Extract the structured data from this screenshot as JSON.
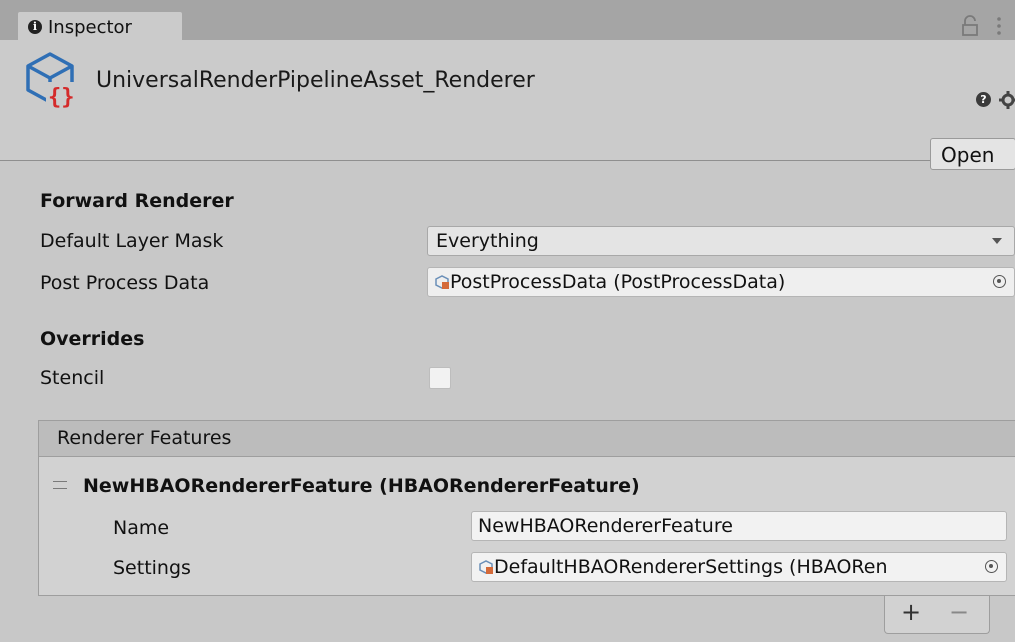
{
  "tab": {
    "label": "Inspector",
    "icon": "info-icon"
  },
  "header": {
    "title": "UniversalRenderPipelineAsset_Renderer",
    "open_label": "Open",
    "help_glyph": "?"
  },
  "forward_renderer": {
    "section_title": "Forward Renderer",
    "default_layer_mask_label": "Default Layer Mask",
    "default_layer_mask_value": "Everything",
    "post_process_data_label": "Post Process Data",
    "post_process_data_value": "PostProcessData (PostProcessData)"
  },
  "overrides": {
    "section_title": "Overrides",
    "stencil_label": "Stencil",
    "stencil_checked": false
  },
  "renderer_features": {
    "header": "Renderer Features",
    "items": [
      {
        "title": "NewHBAORendererFeature (HBAORendererFeature)",
        "name_label": "Name",
        "name_value": "NewHBAORendererFeature",
        "settings_label": "Settings",
        "settings_value": "DefaultHBAORendererSettings (HBAORen"
      }
    ],
    "add_label": "+",
    "remove_label": "−"
  },
  "colors": {
    "background": "#c8c8c8",
    "header_bg": "#cbcbcb",
    "tabbar_bg": "#a5a5a5",
    "asset_icon_blue": "#2f6fb5",
    "asset_icon_red": "#d42a2a"
  }
}
